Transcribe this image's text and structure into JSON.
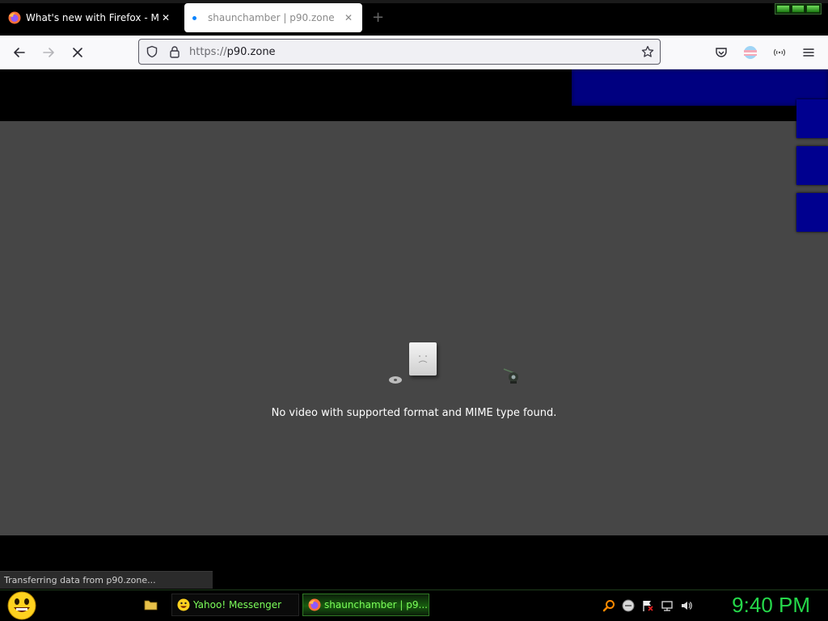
{
  "tabs": [
    {
      "title": "What's new with Firefox - More",
      "active": false,
      "loading": false
    },
    {
      "title": "shaunchamber | p90.zone",
      "active": true,
      "loading": true
    }
  ],
  "new_tab_glyph": "+",
  "url": {
    "protocol": "https://",
    "domain": "p90.zone"
  },
  "video_error": "No video with supported format and MIME type found.",
  "status_text": "Transferring data from p90.zone...",
  "taskbar": {
    "items": [
      {
        "label": "Yahoo! Messenger",
        "icon": "yahoo-smiley-icon",
        "active": false
      },
      {
        "label": "shaunchamber | p9...",
        "icon": "firefox-icon",
        "active": true
      }
    ],
    "tray_icons": [
      "search-icon",
      "messenger-status-icon",
      "action-center-flag-icon",
      "network-icon",
      "volume-icon"
    ],
    "clock": "9:40 PM"
  },
  "colors": {
    "accent_blue": "#0a84ff",
    "banner_blue": "#000080",
    "taskbar_green": "#7cff5a",
    "clock_green": "#25d84a",
    "video_bg": "#464646"
  }
}
